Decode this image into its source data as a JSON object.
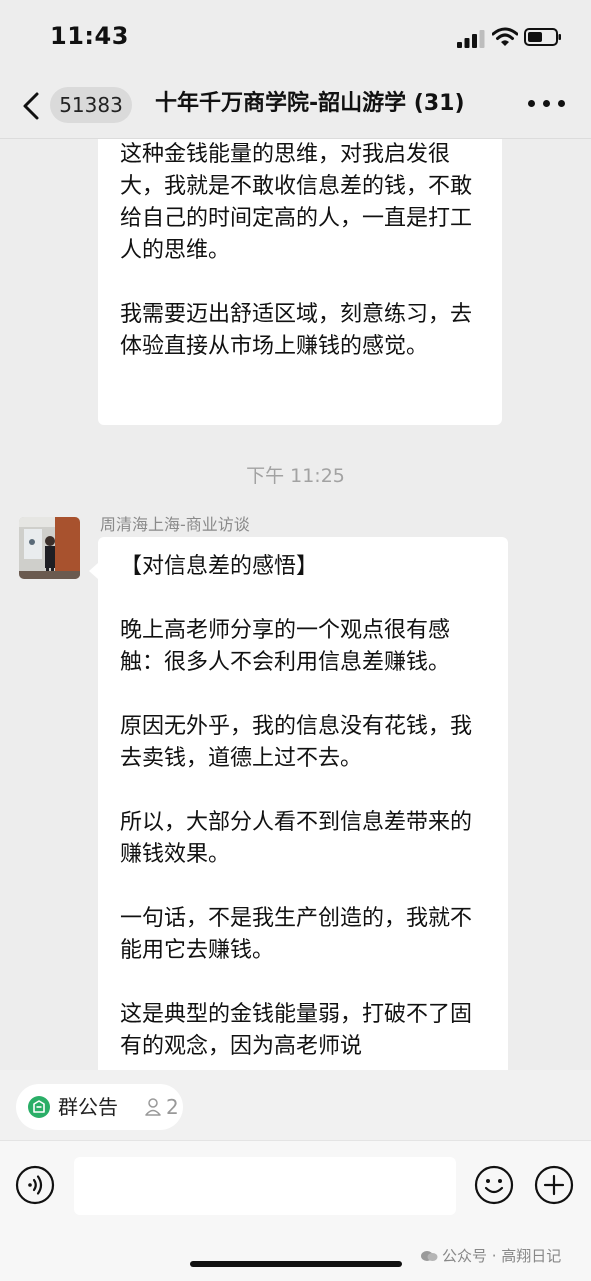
{
  "status_bar": {
    "time": "11:43"
  },
  "nav": {
    "back_label": "<",
    "unread_badge": "51383",
    "chat_title": "十年千万商学院-韶山游学 (31)"
  },
  "messages": {
    "m1_paragraphs": [
      "这种金钱能量的思维，对我启发很大，我就是不敢收信息差的钱，不敢给自己的时间定高的人，一直是打工人的思维。",
      "我需要迈出舒适区域，刻意练习，去体验直接从市场上赚钱的感觉。"
    ],
    "timestamp": "下午 11:25",
    "m2_sender": "周清海上海-商业访谈",
    "m2_paragraphs": [
      "【对信息差的感悟】",
      "晚上高老师分享的一个观点很有感触：很多人不会利用信息差赚钱。",
      "原因无外乎，我的信息没有花钱，我去卖钱，道德上过不去。",
      "所以，大部分人看不到信息差带来的赚钱效果。",
      "一句话，不是我生产创造的，我就不能用它去赚钱。",
      "这是典型的金钱能量弱，打破不了固有的观念，因为高老师说"
    ]
  },
  "announcement": {
    "label": "群公告",
    "count": "2"
  },
  "input": {
    "placeholder": ""
  },
  "watermark": "公众号 · 高翔日记",
  "icons": [
    "back-chevron-icon",
    "more-icon",
    "signal-icon",
    "wifi-icon",
    "battery-icon",
    "announcement-icon",
    "people-icon",
    "voice-icon",
    "emoji-icon",
    "plus-icon"
  ],
  "colors": {
    "background": "#ededed",
    "bubble": "#ffffff",
    "accent_green": "#2aae67"
  }
}
